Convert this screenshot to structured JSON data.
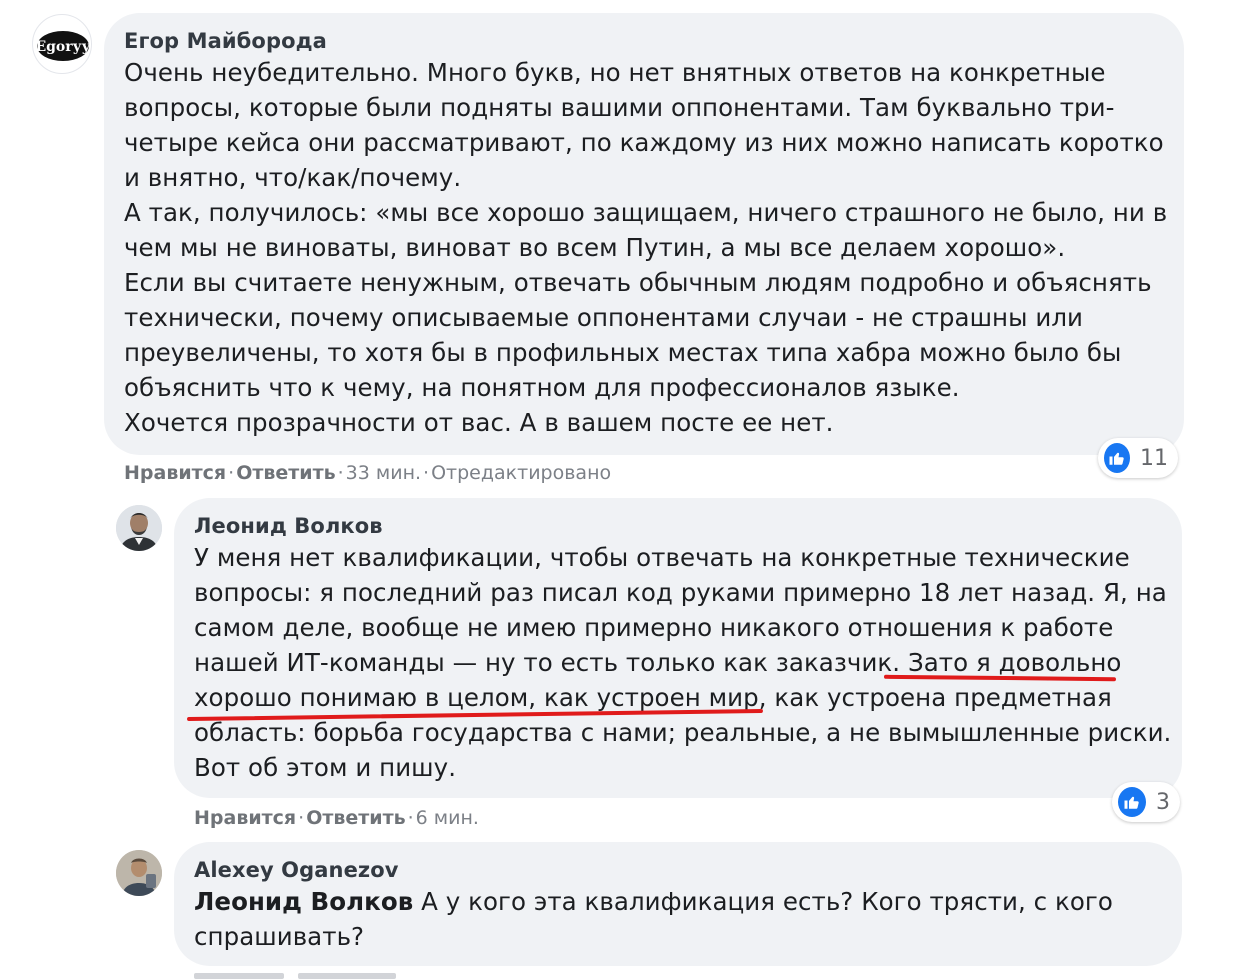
{
  "comments": [
    {
      "author": "Егор Майборода",
      "avatar_text": "Egorуу",
      "lines": [
        "Очень неубедительно. Много букв, но нет внятных ответов на конкретные",
        "вопросы, которые были подняты вашими оппонентами. Там буквально три-",
        "четыре кейса они рассматривают, по каждому из них можно написать коротко",
        "и внятно, что/как/почему.",
        "А так, получилось: «мы все хорошо защищаем, ничего страшного не было, ни в",
        "чем мы не виноваты, виноват во всем Путин, а мы все делаем хорошо».",
        "Если вы считаете ненужным, отвечать обычным людям подробно и объяснять",
        "технически, почему описываемые оппонентами случаи - не страшны или",
        "преувеличены, то хотя бы в профильных местах типа хабра можно было бы",
        "объяснить что к чему, на понятном для профессионалов языке.",
        "Хочется прозрачности от вас. А в вашем посте ее нет."
      ],
      "actions": {
        "like": "Нравится",
        "reply": "Ответить",
        "time": "33 мин.",
        "edited": "Отредактировано"
      },
      "reaction": {
        "icon": "thumbs-up-icon",
        "count": "11"
      }
    },
    {
      "author": "Леонид Волков",
      "lines": [
        "У меня нет квалификации, чтобы отвечать на конкретные технические",
        "вопросы: я последний раз писал код руками примерно 18 лет назад. Я, на",
        "самом деле, вообще не имею примерно никакого отношения к работе",
        "нашей ИТ-команды — ну то есть только как заказчик. Зато я довольно",
        "хорошо понимаю в целом, как устроен мир, как устроена предметная",
        "область: борьба государства с нами; реальные, а не вымышленные риски.",
        "Вот об этом и пишу."
      ],
      "actions": {
        "like": "Нравится",
        "reply": "Ответить",
        "time": "6 мин."
      },
      "reaction": {
        "icon": "thumbs-up-icon",
        "count": "3"
      }
    },
    {
      "author": "Alexey Oganezov",
      "mention": "Леонид Волков",
      "lines": [
        " А у кого эта квалификация есть? Кого трясти, с кого",
        "спрашивать?"
      ]
    }
  ],
  "colors": {
    "bubble": "#f0f2f5",
    "like_blue": "#1877f2",
    "annotation_red": "#e01b1b"
  }
}
